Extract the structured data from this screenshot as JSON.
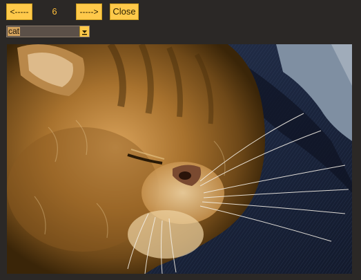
{
  "toolbar": {
    "prev_label": "<-----",
    "index": "6",
    "next_label": "----->",
    "close_label": "Close"
  },
  "category_select": {
    "selected": "cat"
  },
  "icons": {
    "select_arrow": "chevron-down-icon"
  },
  "colors": {
    "background": "#2b2826",
    "button": "#ffc94a",
    "counter_text": "#ffbe3a"
  }
}
